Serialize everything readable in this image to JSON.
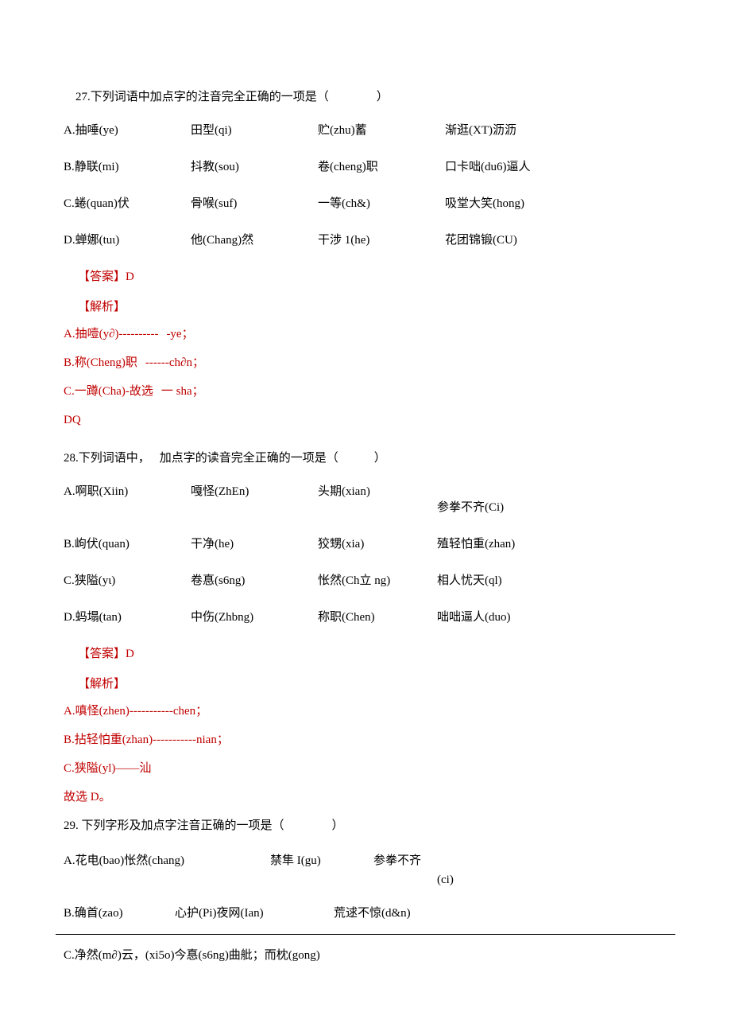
{
  "q27": {
    "stem": "27.下列词语中加点字的注音完全正确的一项是（　　　　）",
    "options": {
      "A": [
        "A.抽唾(ye)",
        "田型(qi)",
        "贮(zhu)蓄",
        "渐逛(XT)沥沥"
      ],
      "B": [
        "B.静联(mi)",
        "抖教(sou)",
        "卷(cheng)职",
        "口卡咄(du6)逼人"
      ],
      "C": [
        "C.蜷(quan)伏",
        "骨喉(suf)",
        "一等(ch&)",
        "吸堂大笑(hong)"
      ],
      "D": [
        "D.蝉娜(tuι)",
        "他(Chang)然",
        "干涉 1(he)",
        "花团锦锻(CU)"
      ]
    },
    "answer": "【答案】D",
    "analysisLabel": "【解析】",
    "analysis": {
      "A": {
        "left": "A.抽噎(y∂)----------",
        "right": "-ye；"
      },
      "B": {
        "left": "B.称(Cheng)职",
        "right": "------ch∂n；"
      },
      "C": {
        "left": "C.一蹲(Cha)-故选",
        "right": "一 sha；"
      },
      "D": "DQ"
    }
  },
  "q28": {
    "stemLead": "28.下列词语中，",
    "stemRest": "加点字的读音完全正确的一项是（　　　）",
    "options": {
      "A": [
        "A.啊职(Xiin)",
        "嘎怪(ZhEn)",
        "头期(xian)",
        "参拳不齐(Ci)"
      ],
      "B": [
        "B.岣伏(quan)",
        "干净(he)",
        "狡甥(xia)",
        "殖轻怕重(zhan)"
      ],
      "C": [
        "C.狭隘(yι)",
        "卷惪(s6ng)",
        "怅然(Ch立 ng)",
        "相人忧天(ql)"
      ],
      "D": [
        "D.蚂塌(tan)",
        "中伤(Zhbng)",
        "称职(Chen)",
        "咄咄逼人(duo)"
      ]
    },
    "answer": "【答案】D",
    "analysisLabel": "【解析】",
    "analysis": {
      "A": "A.嗔怪(zhen)-----------chen；",
      "B": "B.拈轻怕重(zhan)-----------nian；",
      "C": "C.狭隘(yl)——汕",
      "D": "故选 D。"
    }
  },
  "q29": {
    "stem": "29. 下列字形及加点字注音正确的一项是（　　　　）",
    "A": {
      "c1": "A.花电(bao)怅然(chang)",
      "c2": "禁隼 I(gu)",
      "c3": "参拳不齐",
      "ci": "(ci)"
    },
    "B": {
      "c1": "B.确首(zao)",
      "c2": "心护(Pi)夜网(Ian)",
      "c3": "荒逑不惊(d&n)"
    },
    "C": "C.净然(m∂)云，(xi5o)今惪(s6ng)曲舭；而枕(gong)"
  }
}
